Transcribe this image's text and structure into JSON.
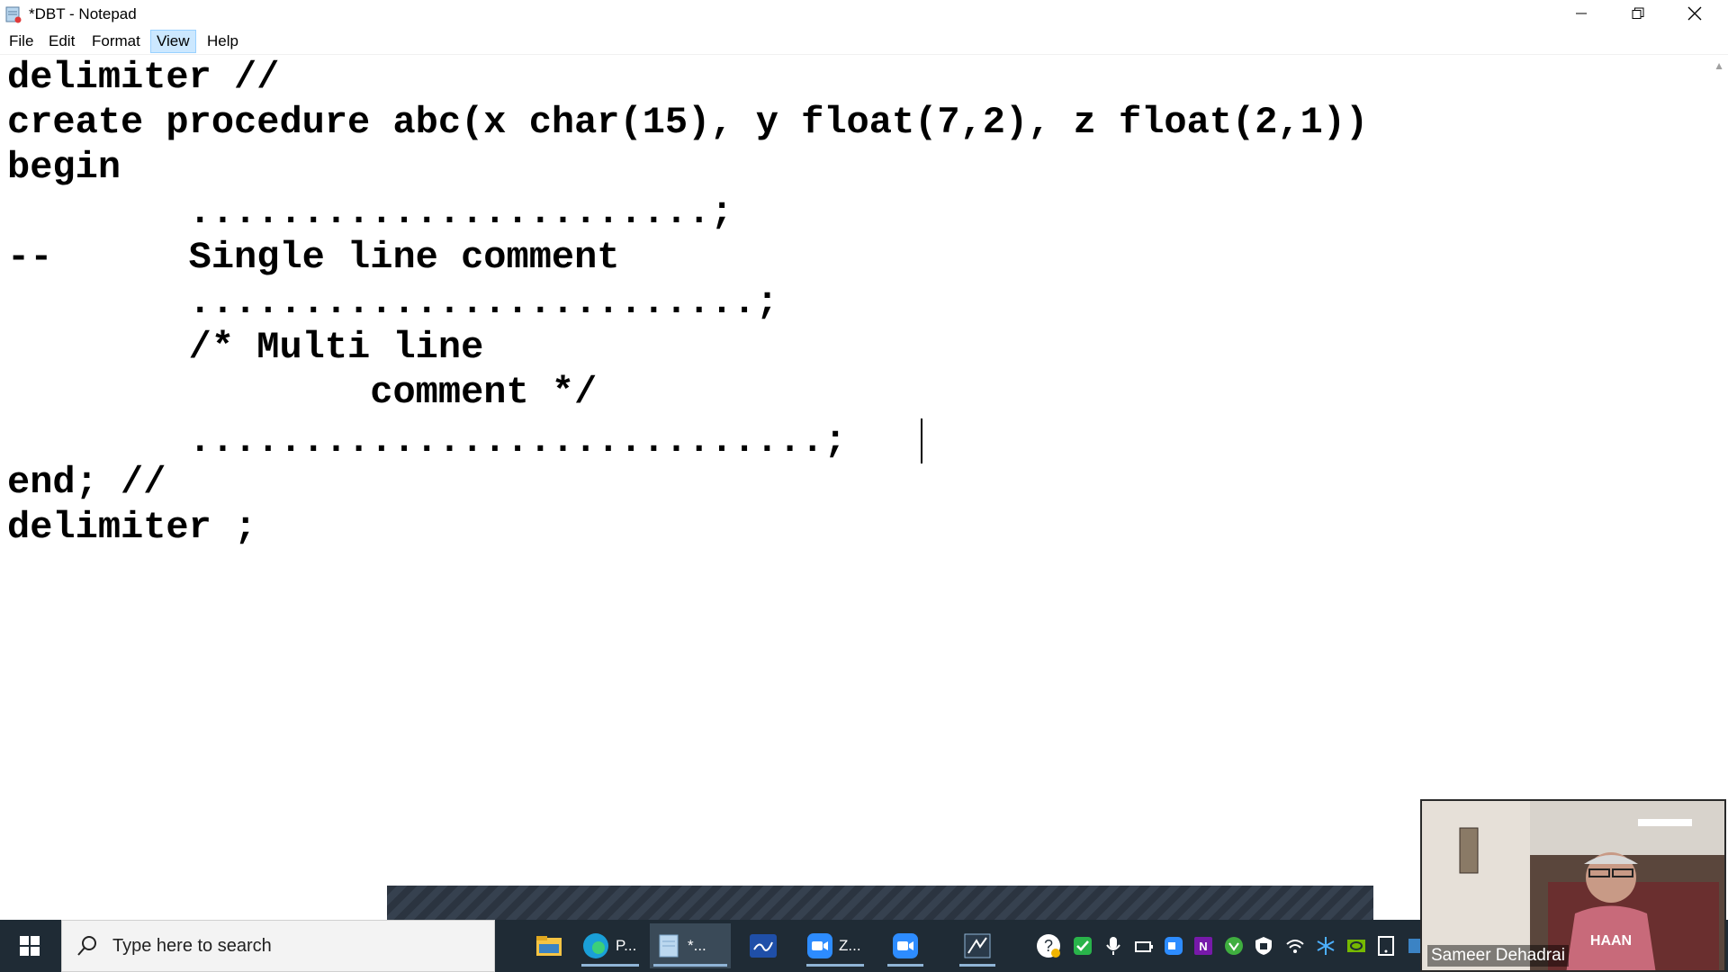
{
  "window": {
    "title": "*DBT - Notepad"
  },
  "menu": {
    "items": [
      "File",
      "Edit",
      "Format",
      "View",
      "Help"
    ],
    "active": "View"
  },
  "editor": {
    "lines": [
      "delimiter //",
      "create procedure abc(x char(15), y float(7,2), z float(2,1))",
      "begin",
      "        .......................;",
      "--      Single line comment",
      "        .........................;",
      "        /* Multi line",
      "                comment */",
      "        ............................;",
      "end; //",
      "delimiter ;"
    ]
  },
  "taskbar": {
    "search_placeholder": "Type here to search",
    "apps": [
      {
        "icon": "file-explorer-icon",
        "label": ""
      },
      {
        "icon": "edge-icon",
        "label": "P..."
      },
      {
        "icon": "notepad-icon",
        "label": "*..."
      },
      {
        "icon": "whiteboard-icon",
        "label": ""
      },
      {
        "icon": "zoom-icon",
        "label": "Z..."
      },
      {
        "icon": "zoom-meeting-icon",
        "label": ""
      },
      {
        "icon": "snipping-tool-icon",
        "label": ""
      }
    ]
  },
  "webcam": {
    "participant_name": "Sameer Dehadrai"
  }
}
